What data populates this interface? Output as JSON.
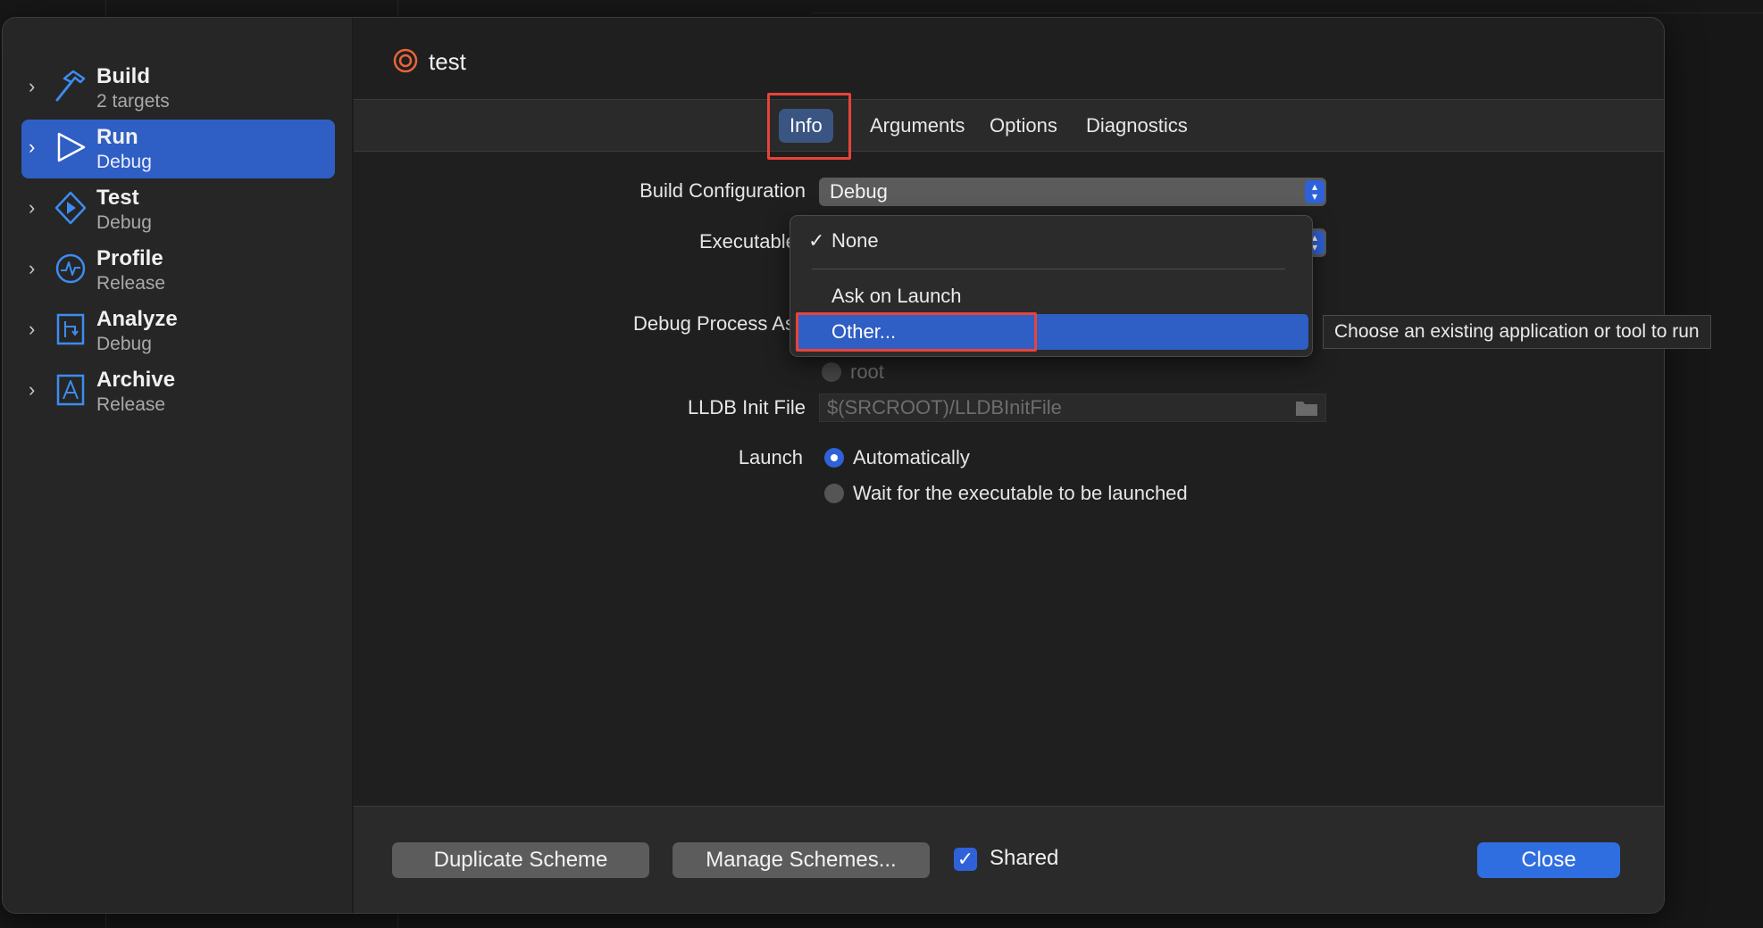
{
  "sidebar": {
    "items": [
      {
        "title": "Build",
        "subtitle": "2 targets"
      },
      {
        "title": "Run",
        "subtitle": "Debug"
      },
      {
        "title": "Test",
        "subtitle": "Debug"
      },
      {
        "title": "Profile",
        "subtitle": "Release"
      },
      {
        "title": "Analyze",
        "subtitle": "Debug"
      },
      {
        "title": "Archive",
        "subtitle": "Release"
      }
    ],
    "selected_index": 1
  },
  "header": {
    "scheme_name": "test"
  },
  "tabs": [
    {
      "label": "Info",
      "active": true
    },
    {
      "label": "Arguments",
      "active": false
    },
    {
      "label": "Options",
      "active": false
    },
    {
      "label": "Diagnostics",
      "active": false
    }
  ],
  "form": {
    "build_configuration_label": "Build Configuration",
    "build_configuration_value": "Debug",
    "executable_label": "Executable",
    "debug_process_label": "Debug Process As",
    "debug_process_partial_option": "root",
    "lldb_init_label": "LLDB Init File",
    "lldb_init_placeholder": "$(SRCROOT)/LLDBInitFile",
    "launch_label": "Launch",
    "launch_options": [
      {
        "label": "Automatically",
        "selected": true
      },
      {
        "label": "Wait for the executable to be launched",
        "selected": false
      }
    ]
  },
  "executable_menu": {
    "check_mark": "✓",
    "items": [
      {
        "label": "None",
        "checked": true
      },
      {
        "label": "Ask on Launch",
        "checked": false
      },
      {
        "label": "Other...",
        "checked": false,
        "highlighted": true
      }
    ]
  },
  "tooltip": {
    "text": "Choose an existing application or tool to run"
  },
  "footer": {
    "duplicate_label": "Duplicate Scheme",
    "manage_label": "Manage Schemes...",
    "shared_label": "Shared",
    "shared_checked": true,
    "close_label": "Close"
  },
  "colors": {
    "accent": "#2f5ec4",
    "highlight_annotation": "#e8433a",
    "icon_blue": "#3d8cf0",
    "scheme_icon": "#e8643a"
  },
  "icons": {
    "build": "hammer-icon",
    "run": "play-icon",
    "test": "test-diamond-icon",
    "profile": "instruments-gauge-icon",
    "analyze": "analyze-icon",
    "archive": "archive-icon",
    "scheme": "target-icon",
    "lldb": "folder-icon"
  }
}
